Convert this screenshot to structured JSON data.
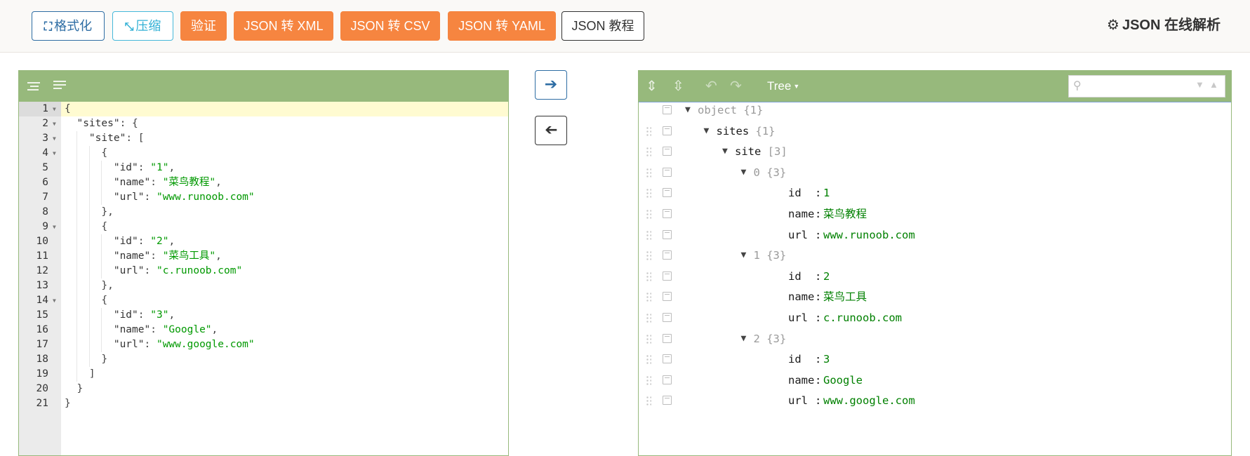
{
  "toolbar": {
    "format_label": "格式化",
    "compress_label": "压缩",
    "validate_label": "验证",
    "to_xml_label": "JSON 转 XML",
    "to_csv_label": "JSON 转 CSV",
    "to_yaml_label": "JSON 转 YAML",
    "tutorial_label": "JSON 教程",
    "app_title": "JSON 在线解析",
    "icons": {
      "format": "expand-icon",
      "compress": "compress-icon",
      "title": "gears-icon"
    }
  },
  "colors": {
    "orange": "#f68540",
    "menu_green": "#97b97c",
    "string_green": "#009900",
    "blue": "#2e6da4",
    "active_line": "#fffbd1"
  },
  "code_editor": {
    "menu_icons": [
      "format-icon",
      "compact-icon"
    ],
    "lines": [
      {
        "n": "1",
        "fold": true,
        "code": "{"
      },
      {
        "n": "2",
        "fold": true,
        "code": "  \"sites\": {"
      },
      {
        "n": "3",
        "fold": true,
        "code": "    \"site\": ["
      },
      {
        "n": "4",
        "fold": true,
        "code": "      {"
      },
      {
        "n": "5",
        "fold": false,
        "code": "        \"id\": \"1\","
      },
      {
        "n": "6",
        "fold": false,
        "code": "        \"name\": \"菜鸟教程\","
      },
      {
        "n": "7",
        "fold": false,
        "code": "        \"url\": \"www.runoob.com\""
      },
      {
        "n": "8",
        "fold": false,
        "code": "      },"
      },
      {
        "n": "9",
        "fold": true,
        "code": "      {"
      },
      {
        "n": "10",
        "fold": false,
        "code": "        \"id\": \"2\","
      },
      {
        "n": "11",
        "fold": false,
        "code": "        \"name\": \"菜鸟工具\","
      },
      {
        "n": "12",
        "fold": false,
        "code": "        \"url\": \"c.runoob.com\""
      },
      {
        "n": "13",
        "fold": false,
        "code": "      },"
      },
      {
        "n": "14",
        "fold": true,
        "code": "      {"
      },
      {
        "n": "15",
        "fold": false,
        "code": "        \"id\": \"3\","
      },
      {
        "n": "16",
        "fold": false,
        "code": "        \"name\": \"Google\","
      },
      {
        "n": "17",
        "fold": false,
        "code": "        \"url\": \"www.google.com\""
      },
      {
        "n": "18",
        "fold": false,
        "code": "      }"
      },
      {
        "n": "19",
        "fold": false,
        "code": "    ]"
      },
      {
        "n": "20",
        "fold": false,
        "code": "  }"
      },
      {
        "n": "21",
        "fold": false,
        "code": "}"
      }
    ]
  },
  "middle": {
    "to_tree_icon": "arrow-right-icon",
    "to_code_icon": "arrow-left-icon"
  },
  "tree_editor": {
    "mode_label": "Tree",
    "search_placeholder": "",
    "tools": [
      "expand-all-icon",
      "collapse-all-icon",
      "undo-icon",
      "redo-icon"
    ],
    "rows": [
      {
        "depth": 0,
        "field": "object",
        "count": "{1}",
        "expandable": true,
        "dim": true,
        "draggable": false
      },
      {
        "depth": 1,
        "field": "sites",
        "count": "{1}",
        "expandable": true,
        "draggable": true
      },
      {
        "depth": 2,
        "field": "site",
        "count": "[3]",
        "expandable": true,
        "draggable": true
      },
      {
        "depth": 3,
        "field": "0",
        "count": "{3}",
        "expandable": true,
        "dim": true,
        "draggable": true
      },
      {
        "depth": 4,
        "field": "id",
        "value": "1",
        "draggable": true
      },
      {
        "depth": 4,
        "field": "name",
        "value": "菜鸟教程",
        "draggable": true
      },
      {
        "depth": 4,
        "field": "url",
        "value": "www.runoob.com",
        "draggable": true
      },
      {
        "depth": 3,
        "field": "1",
        "count": "{3}",
        "expandable": true,
        "dim": true,
        "draggable": true
      },
      {
        "depth": 4,
        "field": "id",
        "value": "2",
        "draggable": true
      },
      {
        "depth": 4,
        "field": "name",
        "value": "菜鸟工具",
        "draggable": true
      },
      {
        "depth": 4,
        "field": "url",
        "value": "c.runoob.com",
        "draggable": true
      },
      {
        "depth": 3,
        "field": "2",
        "count": "{3}",
        "expandable": true,
        "dim": true,
        "draggable": true
      },
      {
        "depth": 4,
        "field": "id",
        "value": "3",
        "draggable": true
      },
      {
        "depth": 4,
        "field": "name",
        "value": "Google",
        "draggable": true
      },
      {
        "depth": 4,
        "field": "url",
        "value": "www.google.com",
        "draggable": true
      }
    ]
  }
}
